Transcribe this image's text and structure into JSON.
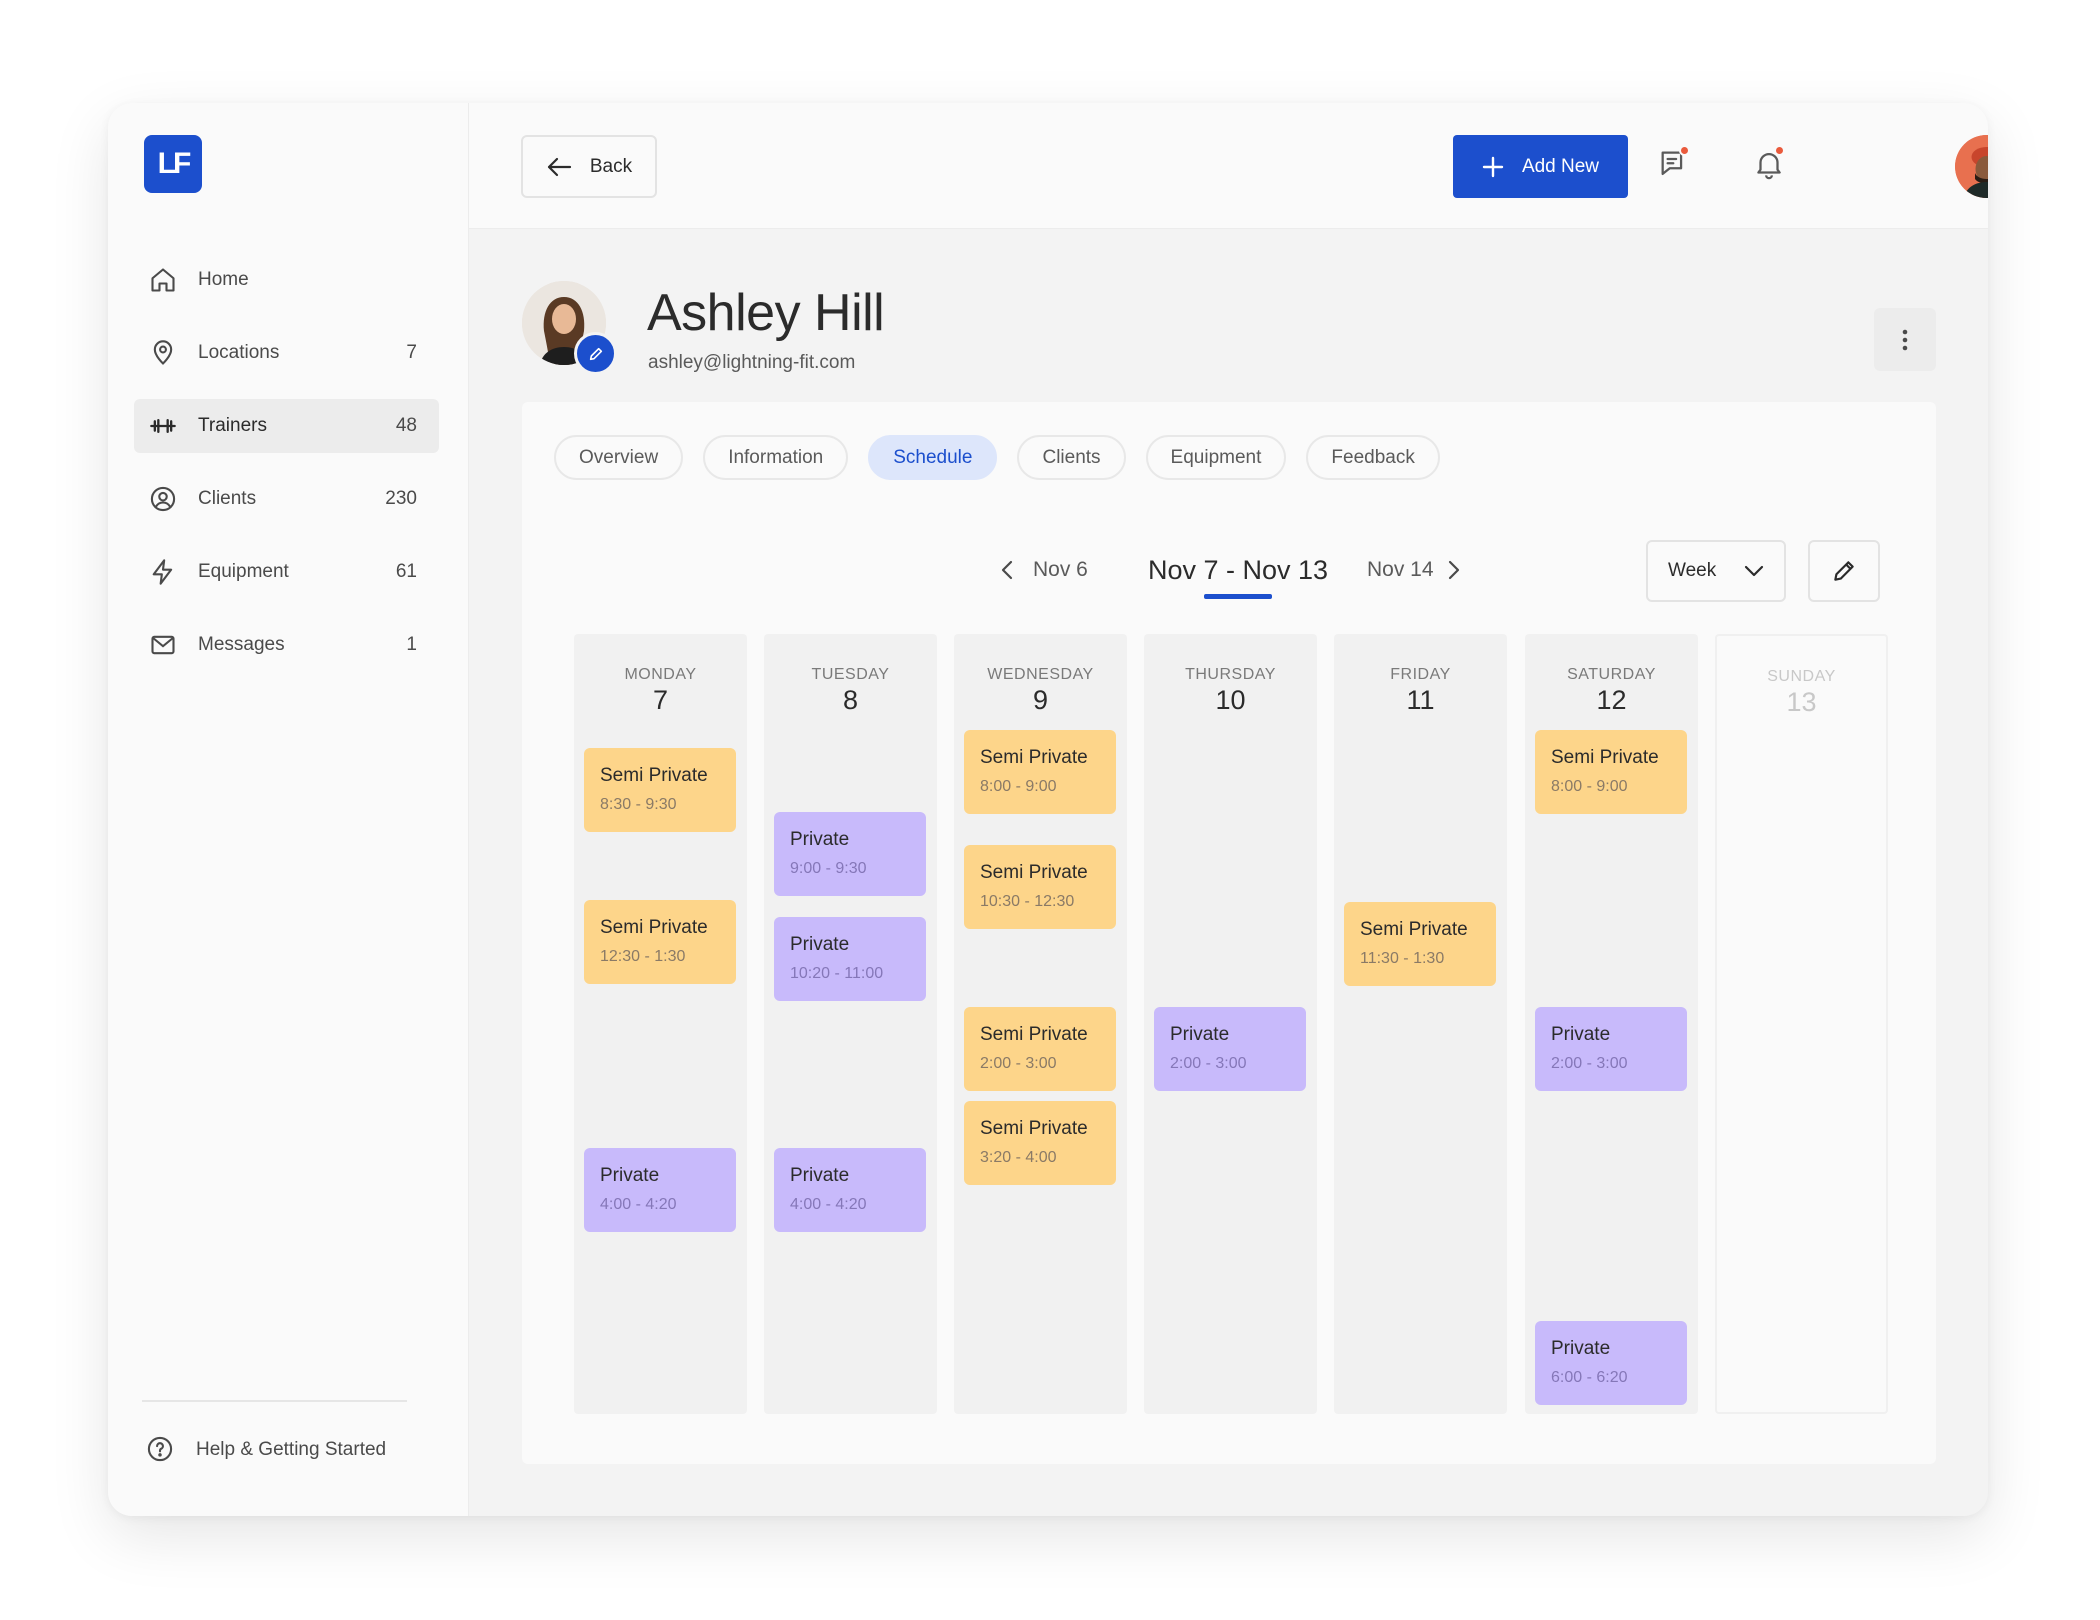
{
  "app": {
    "logo_text": "LF",
    "brand_color": "#1c4fcd"
  },
  "sidebar": {
    "items": [
      {
        "label": "Home",
        "count": "",
        "icon": "home-icon"
      },
      {
        "label": "Locations",
        "count": "7",
        "icon": "location-pin-icon"
      },
      {
        "label": "Trainers",
        "count": "48",
        "icon": "dumbbell-icon",
        "active": true
      },
      {
        "label": "Clients",
        "count": "230",
        "icon": "user-circle-icon"
      },
      {
        "label": "Equipment",
        "count": "61",
        "icon": "lightning-icon"
      },
      {
        "label": "Messages",
        "count": "1",
        "icon": "mail-icon"
      }
    ],
    "help_label": "Help & Getting Started"
  },
  "header": {
    "back_label": "Back",
    "add_label": "Add New",
    "notification_dot_color": "#ea5a3c"
  },
  "profile": {
    "name": "Ashley Hill",
    "email": "ashley@lightning-fit.com"
  },
  "tabs": [
    {
      "label": "Overview"
    },
    {
      "label": "Information"
    },
    {
      "label": "Schedule",
      "active": true
    },
    {
      "label": "Clients"
    },
    {
      "label": "Equipment"
    },
    {
      "label": "Feedback"
    }
  ],
  "schedule": {
    "prev_label": "Nov 6",
    "current_range": "Nov 7 - Nov 13",
    "next_label": "Nov 14",
    "view_select": "Week",
    "event_colors": {
      "semi_private": "#fdd58a",
      "private": "#c8bafb"
    },
    "days": [
      {
        "name": "MONDAY",
        "num": "7",
        "events": [
          {
            "title": "Semi Private",
            "time": "8:30 - 9:30",
            "kind": "semi"
          },
          {
            "title": "Semi Private",
            "time": "12:30 - 1:30",
            "kind": "semi"
          },
          {
            "title": "Private",
            "time": "4:00 - 4:20",
            "kind": "private"
          }
        ]
      },
      {
        "name": "TUESDAY",
        "num": "8",
        "events": [
          {
            "title": "Private",
            "time": "9:00 - 9:30",
            "kind": "private"
          },
          {
            "title": "Private",
            "time": "10:20 - 11:00",
            "kind": "private"
          },
          {
            "title": "Private",
            "time": "4:00 - 4:20",
            "kind": "private"
          }
        ]
      },
      {
        "name": "WEDNESDAY",
        "num": "9",
        "events": [
          {
            "title": "Semi Private",
            "time": "8:00 - 9:00",
            "kind": "semi"
          },
          {
            "title": "Semi Private",
            "time": "10:30 - 12:30",
            "kind": "semi"
          },
          {
            "title": "Semi Private",
            "time": "2:00 - 3:00",
            "kind": "semi"
          },
          {
            "title": "Semi Private",
            "time": "3:20 - 4:00",
            "kind": "semi"
          }
        ]
      },
      {
        "name": "THURSDAY",
        "num": "10",
        "events": [
          {
            "title": "Private",
            "time": "2:00 - 3:00",
            "kind": "private"
          }
        ]
      },
      {
        "name": "FRIDAY",
        "num": "11",
        "events": [
          {
            "title": "Semi Private",
            "time": "11:30 - 1:30",
            "kind": "semi"
          }
        ]
      },
      {
        "name": "SATURDAY",
        "num": "12",
        "events": [
          {
            "title": "Semi Private",
            "time": "8:00 - 9:00",
            "kind": "semi"
          },
          {
            "title": "Private",
            "time": "2:00 - 3:00",
            "kind": "private"
          },
          {
            "title": "Private",
            "time": "6:00 - 6:20",
            "kind": "private"
          }
        ]
      },
      {
        "name": "SUNDAY",
        "num": "13",
        "events": [],
        "dimmed": true
      }
    ]
  }
}
